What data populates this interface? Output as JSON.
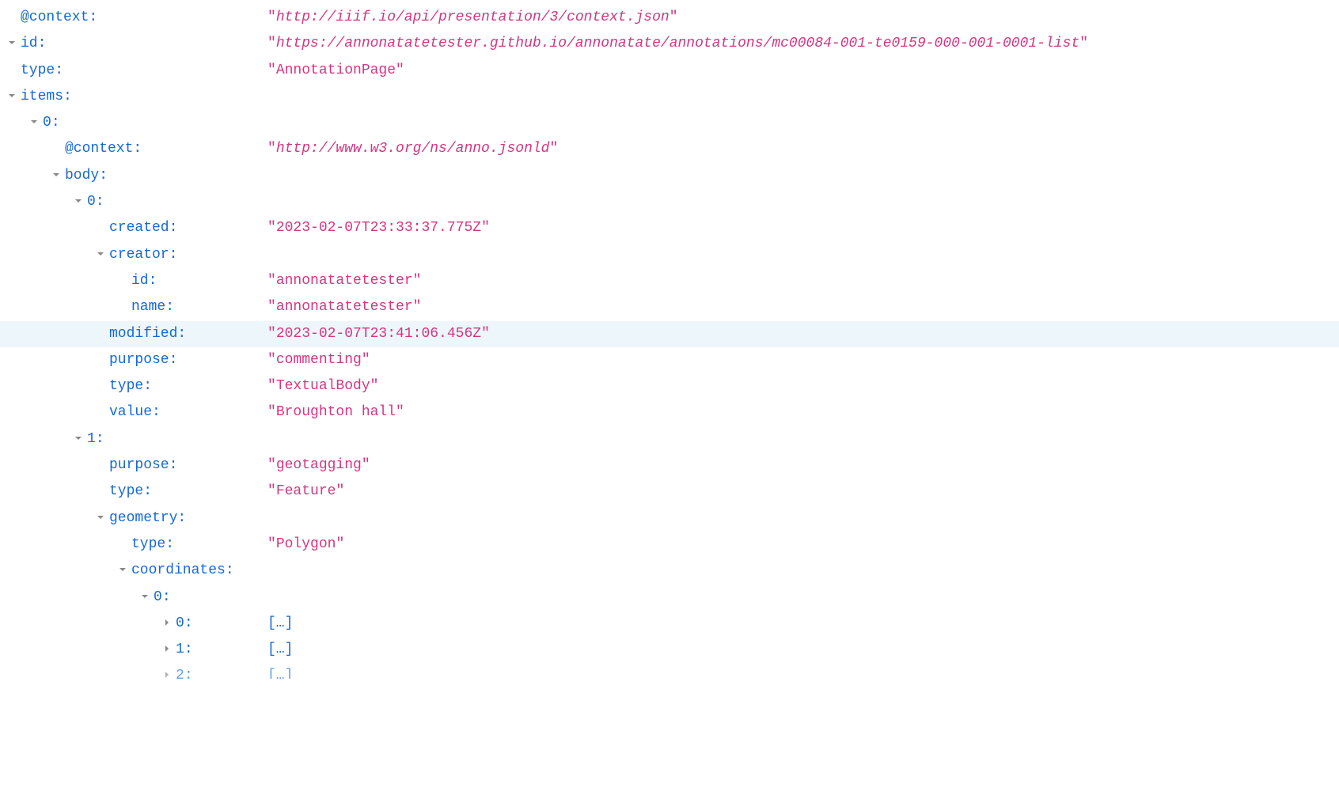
{
  "indent_unit": 28,
  "rows": [
    {
      "indent": 0,
      "toggle": "none",
      "key": "@context",
      "value": "http://iiif.io/api/presentation/3/context.json",
      "quoted": true,
      "italic": true
    },
    {
      "indent": 0,
      "toggle": "down",
      "key": "id",
      "value": "https://annonatatetester.github.io/annonatate/annotations/mc00084-001-te0159-000-001-0001-list",
      "quoted": true,
      "italic": true
    },
    {
      "indent": 0,
      "toggle": "none",
      "key": "type",
      "value": "AnnotationPage",
      "quoted": true
    },
    {
      "indent": 0,
      "toggle": "down",
      "key": "items",
      "value": ""
    },
    {
      "indent": 1,
      "toggle": "down",
      "key": "0",
      "value": ""
    },
    {
      "indent": 2,
      "toggle": "none",
      "key": "@context",
      "value": "http://www.w3.org/ns/anno.jsonld",
      "quoted": true,
      "italic": true
    },
    {
      "indent": 2,
      "toggle": "down",
      "key": "body",
      "value": ""
    },
    {
      "indent": 3,
      "toggle": "down",
      "key": "0",
      "value": ""
    },
    {
      "indent": 4,
      "toggle": "none",
      "key": "created",
      "value": "2023-02-07T23:33:37.775Z",
      "quoted": true
    },
    {
      "indent": 4,
      "toggle": "down",
      "key": "creator",
      "value": ""
    },
    {
      "indent": 5,
      "toggle": "none",
      "key": "id",
      "value": "annonatatetester",
      "quoted": true
    },
    {
      "indent": 5,
      "toggle": "none",
      "key": "name",
      "value": "annonatatetester",
      "quoted": true
    },
    {
      "indent": 4,
      "toggle": "none",
      "key": "modified",
      "value": "2023-02-07T23:41:06.456Z",
      "quoted": true,
      "highlighted": true
    },
    {
      "indent": 4,
      "toggle": "none",
      "key": "purpose",
      "value": "commenting",
      "quoted": true
    },
    {
      "indent": 4,
      "toggle": "none",
      "key": "type",
      "value": "TextualBody",
      "quoted": true
    },
    {
      "indent": 4,
      "toggle": "none",
      "key": "value",
      "value": "Broughton hall",
      "quoted": true
    },
    {
      "indent": 3,
      "toggle": "down",
      "key": "1",
      "value": ""
    },
    {
      "indent": 4,
      "toggle": "none",
      "key": "purpose",
      "value": "geotagging",
      "quoted": true
    },
    {
      "indent": 4,
      "toggle": "none",
      "key": "type",
      "value": "Feature",
      "quoted": true
    },
    {
      "indent": 4,
      "toggle": "down",
      "key": "geometry",
      "value": ""
    },
    {
      "indent": 5,
      "toggle": "none",
      "key": "type",
      "value": "Polygon",
      "quoted": true
    },
    {
      "indent": 5,
      "toggle": "down",
      "key": "coordinates",
      "value": ""
    },
    {
      "indent": 6,
      "toggle": "down",
      "key": "0",
      "value": ""
    },
    {
      "indent": 7,
      "toggle": "right",
      "key": "0",
      "value": "[…]",
      "collapsed": true
    },
    {
      "indent": 7,
      "toggle": "right",
      "key": "1",
      "value": "[…]",
      "collapsed": true
    },
    {
      "indent": 7,
      "toggle": "right",
      "key": "2",
      "value": "[…]",
      "collapsed": true,
      "partial": true
    }
  ]
}
